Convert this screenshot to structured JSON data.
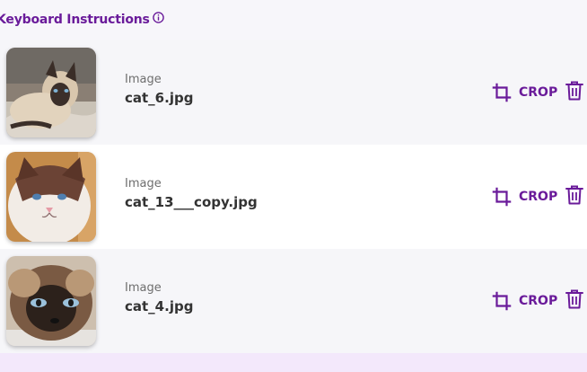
{
  "header": {
    "title": "Keyboard Instructions",
    "info_icon": "info-icon"
  },
  "colors": {
    "accent": "#6a1b9a",
    "row_alt": "#f6f6f9",
    "row_white": "#ffffff",
    "footer_band": "#f3e8fb"
  },
  "files": [
    {
      "type": "Image",
      "name": "cat_6.jpg",
      "crop_label": "CROP",
      "thumbnail": "siamese-cat-on-blanket"
    },
    {
      "type": "Image",
      "name": "cat_13___copy.jpg",
      "crop_label": "CROP",
      "thumbnail": "ragdoll-cat-portrait"
    },
    {
      "type": "Image",
      "name": "cat_4.jpg",
      "crop_label": "CROP",
      "thumbnail": "siamese-cat-closeup"
    }
  ],
  "icons": {
    "crop": "crop-icon",
    "delete": "trash-icon"
  }
}
